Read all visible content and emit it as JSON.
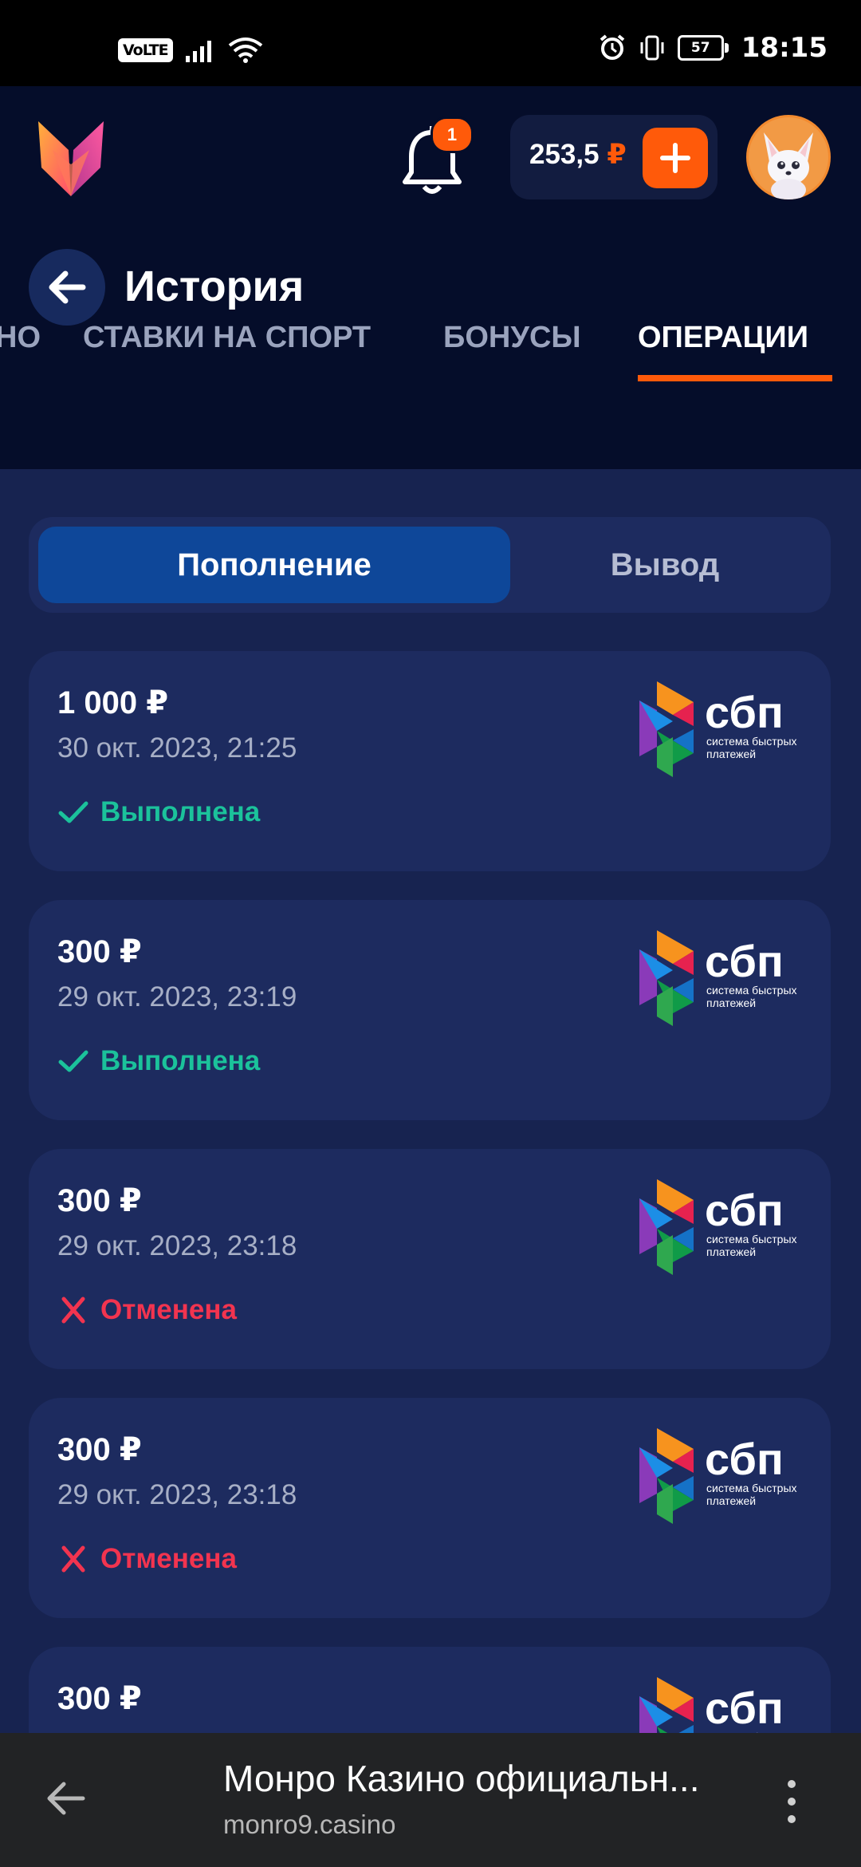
{
  "status_bar": {
    "volte": "VoLTE",
    "battery": "57",
    "time": "18:15"
  },
  "header": {
    "notifications_count": "1",
    "balance_amount": "253,5",
    "balance_currency": "₽",
    "accent_color": "#ff5a0a"
  },
  "page": {
    "title": "История"
  },
  "tabs": [
    {
      "label": "НО",
      "active": false
    },
    {
      "label": "СТАВКИ НА СПОРТ",
      "active": false
    },
    {
      "label": "БОНУСЫ",
      "active": false
    },
    {
      "label": "ОПЕРАЦИИ",
      "active": true
    }
  ],
  "segment": {
    "deposit": "Пополнение",
    "withdraw": "Вывод",
    "selected": "Пополнение"
  },
  "operations": [
    {
      "amount": "1 000 ₽",
      "date": "30 окт. 2023, 21:25",
      "status": "Выполнена",
      "status_type": "success",
      "method": "сбп"
    },
    {
      "amount": "300 ₽",
      "date": "29 окт. 2023, 23:19",
      "status": "Выполнена",
      "status_type": "success",
      "method": "сбп"
    },
    {
      "amount": "300 ₽",
      "date": "29 окт. 2023, 23:18",
      "status": "Отменена",
      "status_type": "cancelled",
      "method": "сбп"
    },
    {
      "amount": "300 ₽",
      "date": "29 окт. 2023, 23:18",
      "status": "Отменена",
      "status_type": "cancelled",
      "method": "сбп"
    },
    {
      "amount": "300 ₽",
      "date": "",
      "status": "",
      "status_type": "",
      "method": "сбп"
    }
  ],
  "sbp_logo": {
    "name": "сбп",
    "subtitle_line1": "система быстрых",
    "subtitle_line2": "платежей"
  },
  "browser": {
    "title": "Монро Казино официальн...",
    "url": "monro9.casino"
  }
}
